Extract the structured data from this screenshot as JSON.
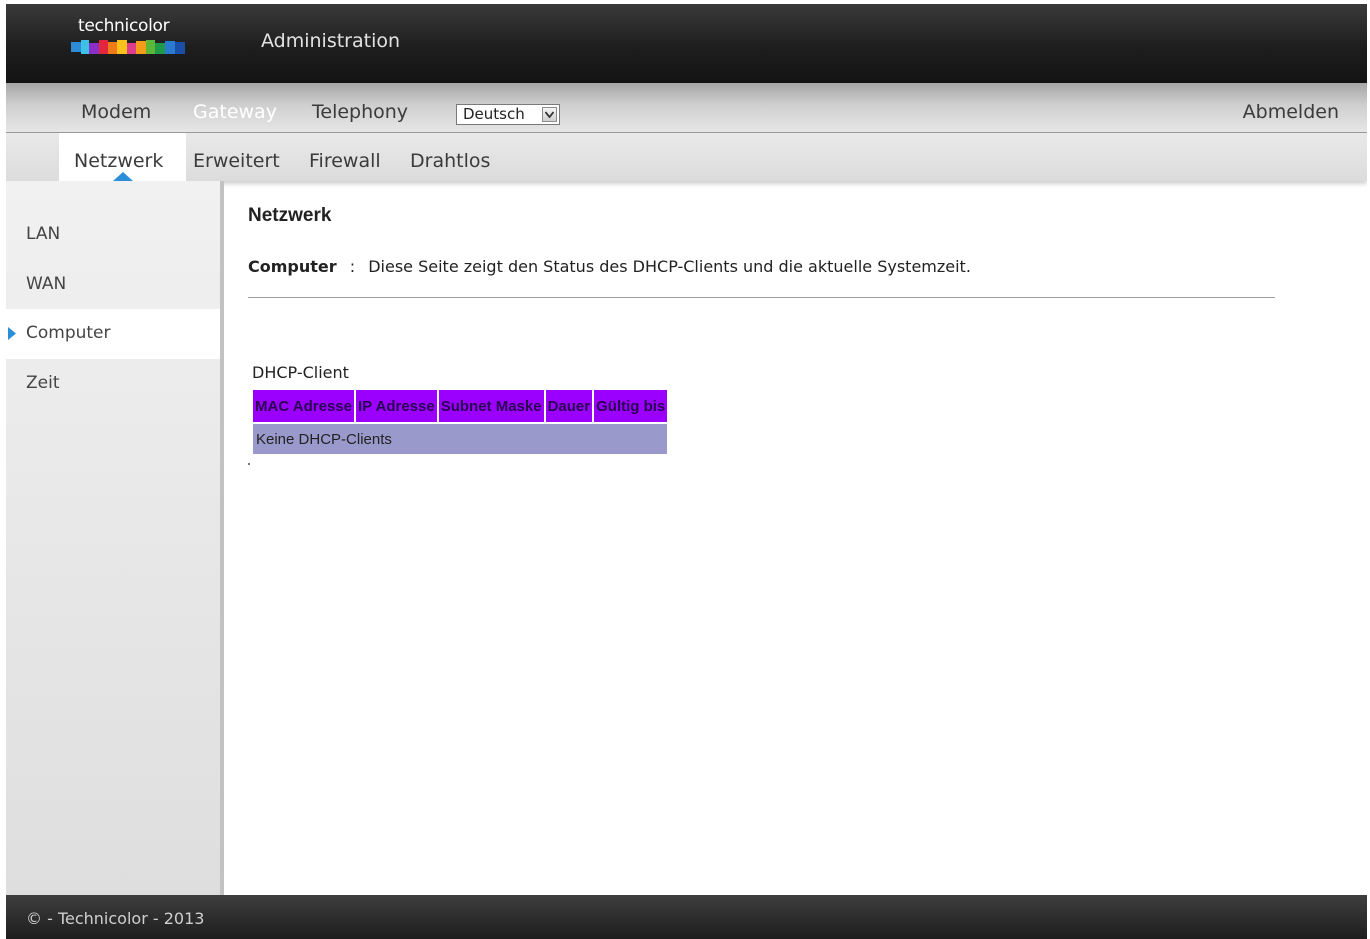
{
  "header": {
    "brand": "technicolor",
    "title": "Administration"
  },
  "top_nav": {
    "items": [
      "Modem",
      "Gateway",
      "Telephony"
    ],
    "active": "Gateway",
    "language": "Deutsch",
    "logout": "Abmelden"
  },
  "sub_nav": {
    "items": [
      "Netzwerk",
      "Erweitert",
      "Firewall",
      "Drahtlos"
    ],
    "active": "Netzwerk"
  },
  "sidebar": {
    "items": [
      "LAN",
      "WAN",
      "Computer",
      "Zeit"
    ],
    "active": "Computer"
  },
  "main": {
    "title": "Netzwerk",
    "desc_label": "Computer",
    "desc_sep": ":",
    "desc_text": "Diese Seite zeigt den Status des DHCP-Clients und die aktuelle Systemzeit.",
    "section_label": "DHCP-Client",
    "table": {
      "headers": [
        "MAC Adresse",
        "IP Adresse",
        "Subnet Maske",
        "Dauer",
        "Gültig bis"
      ],
      "empty_text": "Keine DHCP-Clients"
    }
  },
  "footer": {
    "text": "© - Technicolor - 2013"
  },
  "colors": {
    "table_header": "#9b00ff",
    "table_row": "#9a99cc",
    "accent_arrow": "#2a8fd8"
  }
}
